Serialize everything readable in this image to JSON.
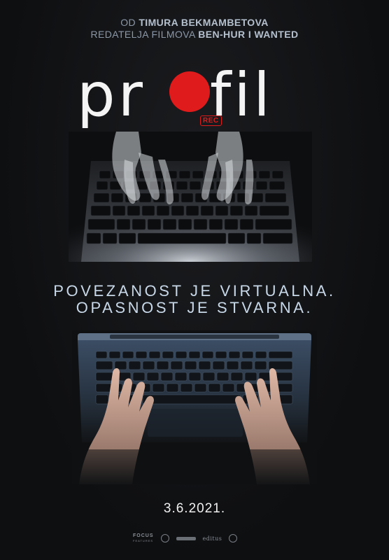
{
  "credits": {
    "line1_prefix": "OD",
    "line1_name": "TIMURA BEKMAMBETOVA",
    "line2_prefix": "REDATELJA FILMOVA",
    "line2_films": "BEN-HUR I WANTED"
  },
  "title": {
    "part1": "pr",
    "part2": "fil",
    "rec_badge": "REC"
  },
  "tagline": {
    "line1": "POVEZANOST JE VIRTUALNA.",
    "line2": "OPASNOST JE STVARNA."
  },
  "release_date": "3.6.2021.",
  "distributors": {
    "focus": "FOCUS",
    "focus_sub": "FEATURES",
    "editus": "editus"
  },
  "colors": {
    "rec_red": "#e01b1b",
    "tagline_blue": "#c8d8e8"
  }
}
